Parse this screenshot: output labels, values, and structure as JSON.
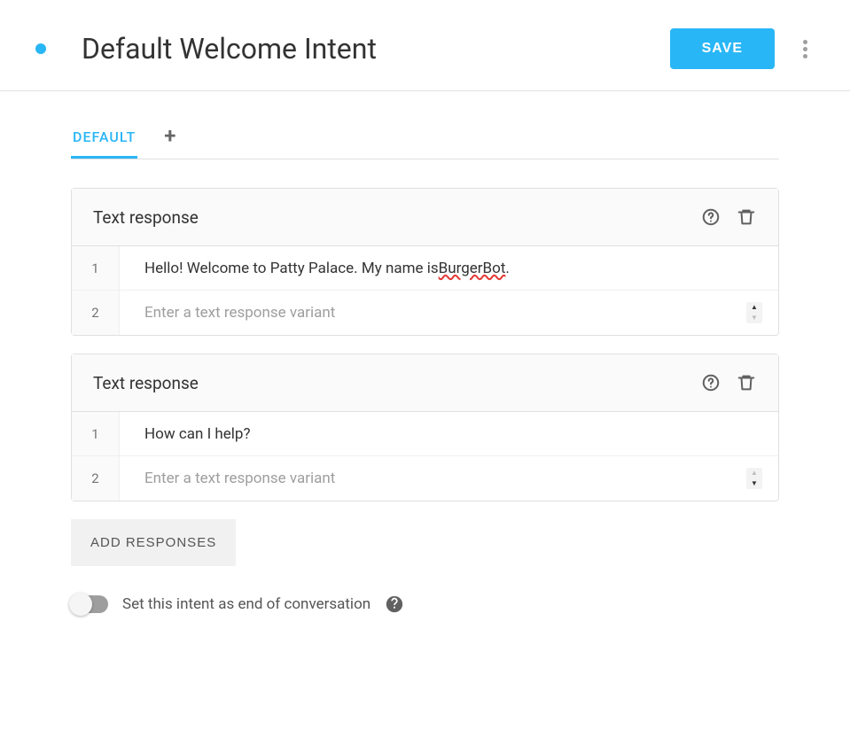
{
  "header": {
    "title": "Default Welcome Intent",
    "save_label": "SAVE"
  },
  "tabs": {
    "active": "DEFAULT"
  },
  "responses": [
    {
      "title": "Text response",
      "rows": [
        {
          "num": "1",
          "text_pre": "Hello! Welcome to Patty Palace. My name is ",
          "text_spell": "BurgerBot",
          "text_post": "."
        },
        {
          "num": "2",
          "placeholder": "Enter a text response variant",
          "stepper_up_dim": false,
          "stepper_down_dim": true
        }
      ]
    },
    {
      "title": "Text response",
      "rows": [
        {
          "num": "1",
          "text": "How can I help?"
        },
        {
          "num": "2",
          "placeholder": "Enter a text response variant",
          "stepper_up_dim": true,
          "stepper_down_dim": false
        }
      ]
    }
  ],
  "add_responses_label": "ADD RESPONSES",
  "end_conversation_label": "Set this intent as end of conversation"
}
